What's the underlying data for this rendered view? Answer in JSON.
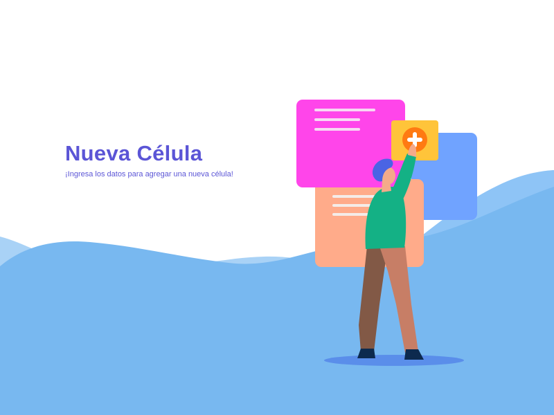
{
  "header": {
    "title": "Nueva Célula",
    "subtitle": "¡Ingresa los datos para agregar una nueva célula!"
  },
  "illustration": {
    "icons": [
      "plus-icon"
    ]
  },
  "colors": {
    "title": "#5b55d6",
    "subtitle": "#5b55d6",
    "wave_front": "#78b8f0",
    "wave_back": "#a9d2f6",
    "wave_right": "#8ec4f6",
    "card_pink": "#ff45ea",
    "card_blue": "#70a3ff",
    "card_peach": "#ffab8a",
    "card_yellow": "#ffc43a",
    "plus_circle": "#ff7a12",
    "shirt": "#14b185",
    "hair": "#4a64e4",
    "skin": "#f4aa8a",
    "pants_front": "#c77e66",
    "pants_back": "#825946",
    "shoes": "#0d2a4e",
    "shadow": "#5a8eea"
  }
}
